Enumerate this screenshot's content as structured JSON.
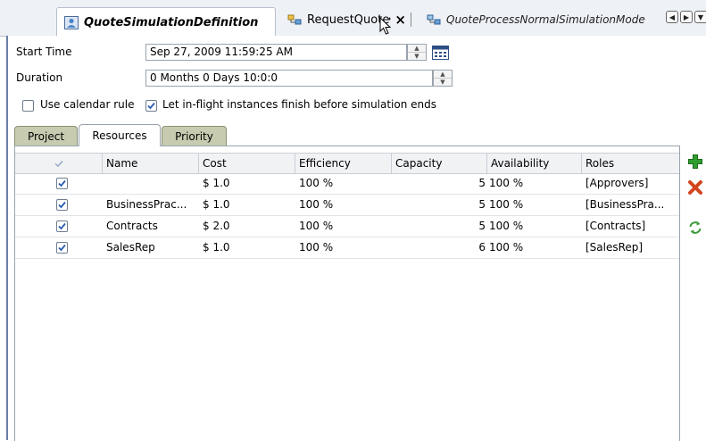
{
  "editor_tabs": [
    {
      "label": "QuoteSimulationDefinition",
      "active": true
    },
    {
      "label": "RequestQuote",
      "active": false
    },
    {
      "label": "QuoteProcessNormalSimulationMode",
      "active": false
    }
  ],
  "form": {
    "start_time_label": "Start Time",
    "start_time_value": "Sep 27, 2009 11:59:25 AM",
    "duration_label": "Duration",
    "duration_value": "0 Months 0 Days 10:0:0",
    "use_calendar_label": "Use calendar rule",
    "use_calendar_checked": false,
    "let_inflight_label": "Let in-flight instances finish before simulation ends",
    "let_inflight_checked": true
  },
  "sub_tabs": [
    {
      "label": "Project",
      "active": false
    },
    {
      "label": "Resources",
      "active": true
    },
    {
      "label": "Priority",
      "active": false
    }
  ],
  "table": {
    "columns": [
      "",
      "Name",
      "Cost",
      "Efficiency",
      "Capacity",
      "Availability",
      "Roles"
    ],
    "rows": [
      {
        "checked": true,
        "name": "",
        "cost": "$ 1.0",
        "efficiency": "100 %",
        "capacity": "5",
        "availability": "100 %",
        "roles": "[Approvers]"
      },
      {
        "checked": true,
        "name": "BusinessPrac...",
        "cost": "$ 1.0",
        "efficiency": "100 %",
        "capacity": "5",
        "availability": "100 %",
        "roles": "[BusinessPra..."
      },
      {
        "checked": true,
        "name": "Contracts",
        "cost": "$ 2.0",
        "efficiency": "100 %",
        "capacity": "5",
        "availability": "100 %",
        "roles": "[Contracts]"
      },
      {
        "checked": true,
        "name": "SalesRep",
        "cost": "$ 1.0",
        "efficiency": "100 %",
        "capacity": "6",
        "availability": "100 %",
        "roles": "[SalesRep]"
      }
    ]
  },
  "colors": {
    "accent_green": "#2e9e2e",
    "delete_red": "#d2451e",
    "frame_blue": "#6a7fa6",
    "checkbox_blue": "#2a5db0"
  },
  "icons": {
    "add": "plus-icon",
    "delete": "delete-icon",
    "refresh": "refresh-icon"
  }
}
